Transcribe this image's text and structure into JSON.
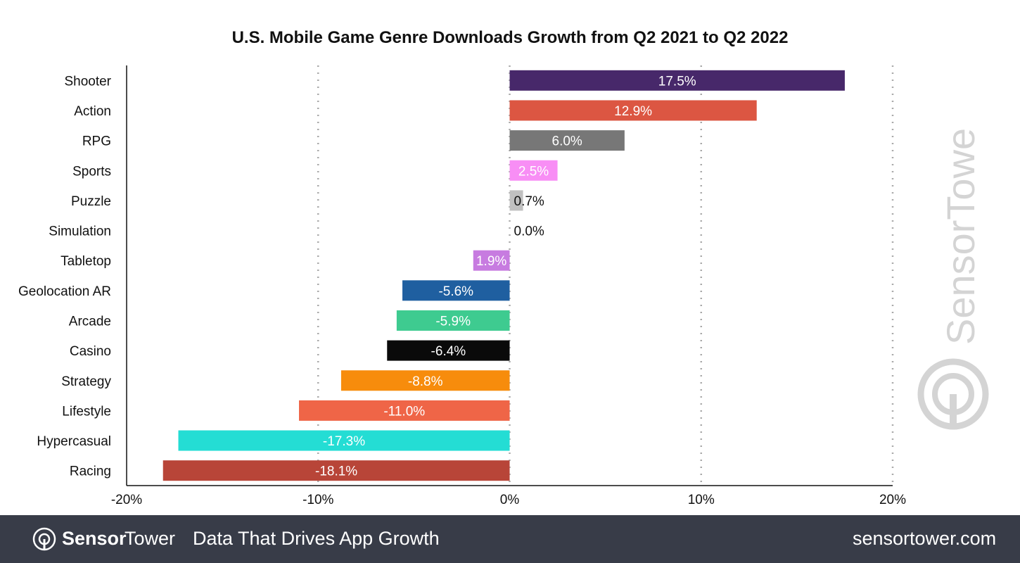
{
  "chart_data": {
    "type": "bar",
    "orientation": "horizontal",
    "title": "U.S. Mobile Game Genre Downloads Growth from Q2 2021 to Q2 2022",
    "categories": [
      "Shooter",
      "Action",
      "RPG",
      "Sports",
      "Puzzle",
      "Simulation",
      "Tabletop",
      "Geolocation AR",
      "Arcade",
      "Casino",
      "Strategy",
      "Lifestyle",
      "Hypercasual",
      "Racing"
    ],
    "values": [
      17.5,
      12.9,
      6.0,
      2.5,
      0.7,
      0.0,
      -1.9,
      -5.6,
      -5.9,
      -6.4,
      -8.8,
      -11.0,
      -17.3,
      -18.1
    ],
    "labels": [
      "17.5%",
      "12.9%",
      "6.0%",
      "2.5%",
      "0.7%",
      "0.0%",
      "1.9%",
      "-5.6%",
      "-5.9%",
      "-6.4%",
      "-8.8%",
      "-11.0%",
      "-17.3%",
      "-18.1%"
    ],
    "colors": [
      "#47286a",
      "#dc5642",
      "#777777",
      "#f88ef5",
      "#c0c0c0",
      "#cccccc",
      "#c77be0",
      "#1f5fa0",
      "#3ecb90",
      "#0a0a0a",
      "#f78c0c",
      "#ef6547",
      "#24ddd4",
      "#b84538"
    ],
    "xticks": [
      -20,
      -10,
      0,
      10,
      20
    ],
    "xtick_labels": [
      "-20%",
      "-10%",
      "0%",
      "10%",
      "20%"
    ],
    "xlim": [
      -20,
      20
    ],
    "grid": true,
    "xlabel": "",
    "ylabel": ""
  },
  "watermark": "SensorTower",
  "footer": {
    "brand_bold": "Sensor",
    "brand_light": "Tower",
    "tagline": "Data That Drives App Growth",
    "url": "sensortower.com"
  }
}
